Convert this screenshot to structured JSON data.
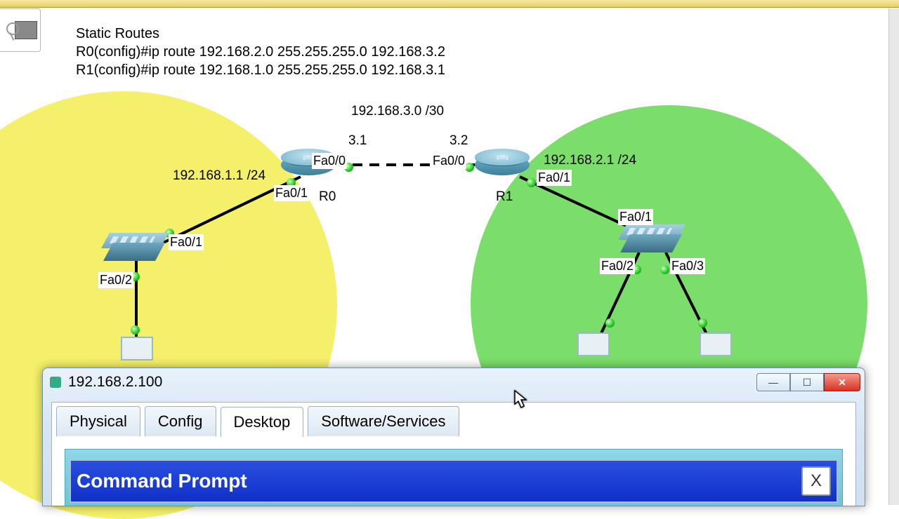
{
  "notes": {
    "title": "Static Routes",
    "line1": "R0(config)#ip route 192.168.2.0 255.255.255.0 192.168.3.2",
    "line2": "R1(config)#ip route 192.168.1.0 255.255.255.0 192.168.3.1"
  },
  "topology": {
    "link_subnet": "192.168.3.0 /30",
    "r0": {
      "name": "R0",
      "fa00": "Fa0/0",
      "fa01": "Fa0/1",
      "ip_fa00": "3.1",
      "lan": "192.168.1.1 /24"
    },
    "r1": {
      "name": "R1",
      "fa00": "Fa0/0",
      "fa01": "Fa0/1",
      "ip_fa00": "3.2",
      "lan": "192.168.2.1 /24"
    },
    "sw_left": {
      "fa01": "Fa0/1",
      "fa02": "Fa0/2"
    },
    "sw_right": {
      "fa01": "Fa0/1",
      "fa02": "Fa0/2",
      "fa03": "Fa0/3"
    }
  },
  "window": {
    "title": "192.168.2.100",
    "tabs": {
      "physical": "Physical",
      "config": "Config",
      "desktop": "Desktop",
      "software": "Software/Services"
    },
    "cmd_title": "Command Prompt",
    "cmd_close": "X"
  }
}
